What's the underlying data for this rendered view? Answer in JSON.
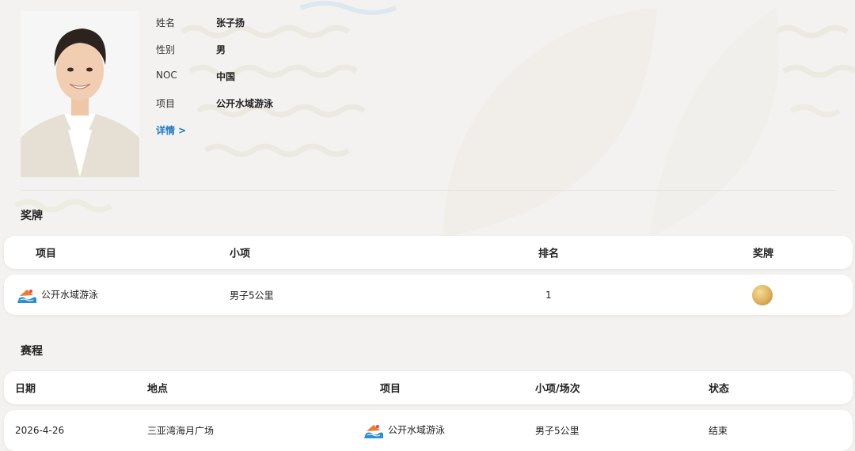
{
  "profile": {
    "fields": [
      {
        "label": "姓名",
        "value": "张子扬"
      },
      {
        "label": "性别",
        "value": "男"
      },
      {
        "label": "NOC",
        "value": "中国"
      },
      {
        "label": "项目",
        "value": "公开水域游泳"
      }
    ],
    "detail_link": "详情 >"
  },
  "medals": {
    "title": "奖牌",
    "headers": {
      "event": "项目",
      "sub_event": "小项",
      "rank": "排名",
      "medal": "奖牌"
    },
    "rows": [
      {
        "event": "公开水域游泳",
        "sub_event": "男子5公里",
        "rank": "1",
        "medal": "gold-medal-icon"
      }
    ]
  },
  "schedule": {
    "title": "赛程",
    "headers": {
      "date": "日期",
      "venue": "地点",
      "event": "项目",
      "sub_event": "小项/场次",
      "status": "状态"
    },
    "rows": [
      {
        "date": "2026-4-26",
        "venue": "三亚湾海月广场",
        "event": "公开水域游泳",
        "sub_event": "男子5公里",
        "status": "结束"
      }
    ]
  },
  "colors": {
    "link": "#1a79c9",
    "medal_gold": "#deb05a",
    "background": "#f3f2f0"
  },
  "icons": {
    "event_icon": "open-water-swimming-icon"
  }
}
